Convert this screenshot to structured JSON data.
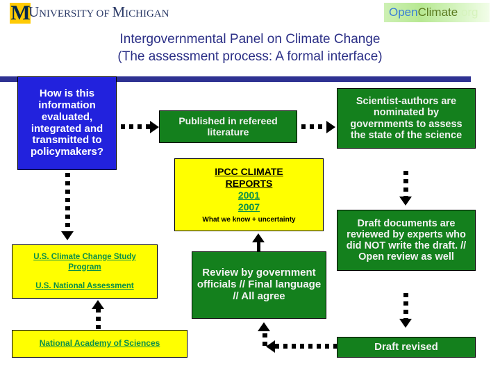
{
  "header": {
    "university_logo": {
      "block_letter": "M",
      "wordmark_1": "U",
      "wordmark_2": "NIVERSITY OF ",
      "wordmark_3": "M",
      "wordmark_4": "ICHIGAN"
    },
    "openclimate_logo": {
      "part_open": "Open",
      "part_climate": "Climate",
      "part_org": ".org"
    }
  },
  "title": {
    "line1": "Intergovernmental Panel on Climate Change",
    "line2": "(The assessment process: A formal interface)"
  },
  "boxes": {
    "question": "How is this information evaluated, integrated and transmitted to policymakers?",
    "published": "Published in refereed literature",
    "ipcc_reports": {
      "title_line1": "IPCC CLIMATE",
      "title_line2": "REPORTS",
      "year1": "2001",
      "year2": "2007",
      "caption": "What we know + uncertainty"
    },
    "us_program": {
      "link1": "U.S. Climate Change Study Program",
      "link2": "U.S. National Assessment"
    },
    "national_academy": "National Academy of Sciences",
    "review": "Review by government officials // Final language // All agree",
    "scientist_authors": "Scientist-authors are nominated by governments to assess the state of the science",
    "draft_reviewed": "Draft documents are reviewed by experts who did NOT write the draft.  // Open review as well",
    "draft_revised": "Draft revised"
  },
  "colors": {
    "navy_bar": "#2e3192",
    "blue_box": "#2222dd",
    "green_box": "#14801d",
    "yellow_box": "#ffff00",
    "green_link": "#0a8f4a",
    "title_text": "#2b2f86",
    "maize": "#FFCB05"
  }
}
